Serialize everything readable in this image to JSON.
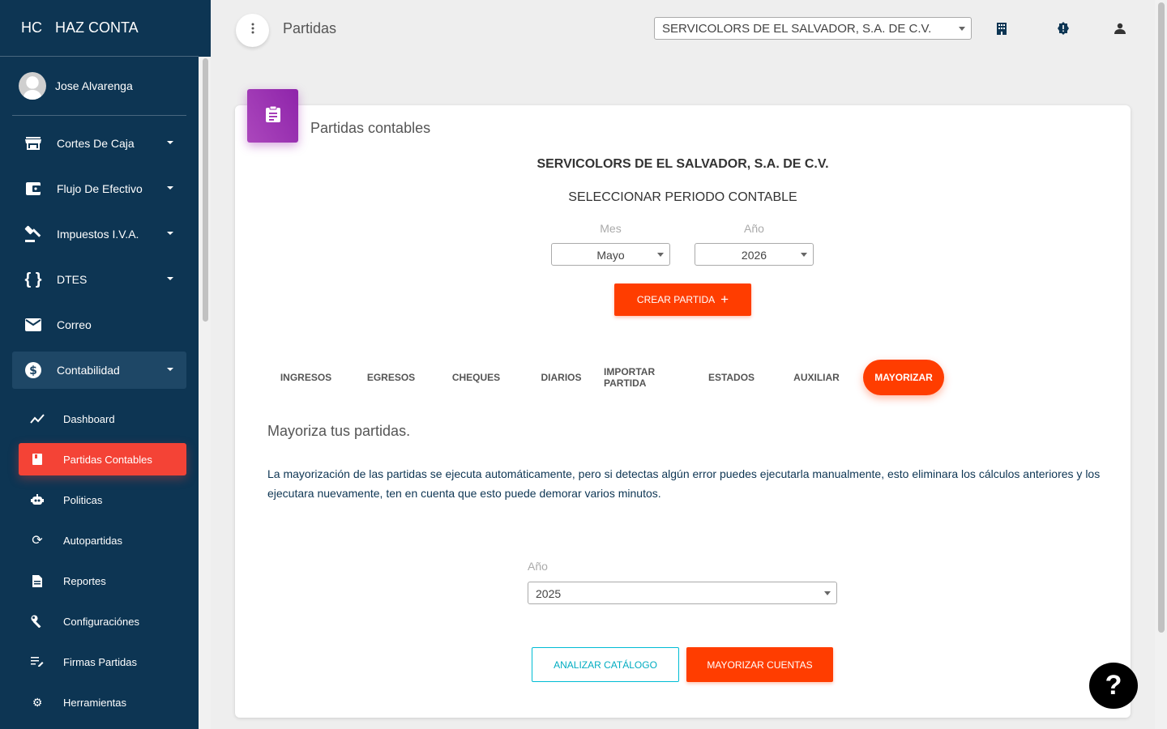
{
  "sidebar": {
    "brand_mini": "HC",
    "brand_name": "HAZ CONTA",
    "user_name": "Jose Alvarenga",
    "items": [
      {
        "label": "Cortes De Caja",
        "icon": "store-icon"
      },
      {
        "label": "Flujo De Efectivo",
        "icon": "wallet-icon"
      },
      {
        "label": "Impuestos I.V.A.",
        "icon": "gavel-icon"
      },
      {
        "label": "DTES",
        "icon": "braces-icon"
      },
      {
        "label": "Correo",
        "icon": "mail-icon"
      },
      {
        "label": "Contabilidad",
        "icon": "dollar-icon"
      }
    ],
    "sub_items": [
      {
        "label": "Dashboard",
        "icon": "trend-icon"
      },
      {
        "label": "Partidas Contables",
        "icon": "book-icon"
      },
      {
        "label": "Politicas",
        "icon": "robot-icon"
      },
      {
        "label": "Autopartidas",
        "icon": "sync-icon"
      },
      {
        "label": "Reportes",
        "icon": "document-icon"
      },
      {
        "label": "Configuraciónes",
        "icon": "wrench-icon"
      },
      {
        "label": "Firmas Partidas",
        "icon": "edit-list-icon"
      },
      {
        "label": "Herramientas",
        "icon": "gears-icon"
      }
    ]
  },
  "topbar": {
    "title": "Partidas",
    "company_selected": "SERVICOLORS DE EL SALVADOR, S.A. DE C.V.",
    "icons": [
      "building-icon",
      "alert-badge-icon",
      "person-icon"
    ]
  },
  "card": {
    "title": "Partidas contables",
    "company_name": "SERVICOLORS DE EL SALVADOR, S.A. DE C.V.",
    "period_title": "SELECCIONAR PERIODO CONTABLE",
    "month_label": "Mes",
    "month_value": "Mayo",
    "year_label": "Año",
    "year_value": "2026",
    "create_button": "CREAR PARTIDA",
    "tabs": [
      "INGRESOS",
      "EGRESOS",
      "CHEQUES",
      "DIARIOS",
      "IMPORTAR PARTIDA",
      "ESTADOS",
      "AUXILIAR",
      "MAYORIZAR"
    ],
    "active_tab": "MAYORIZAR",
    "section_title": "Mayoriza tus partidas.",
    "description": "La mayorización de las partidas se ejecuta automáticamente, pero si detectas algún error puedes ejecutarla manualmente, esto eliminara los cálculos anteriores y los ejecutara nuevamente, ten en cuenta que esto puede demorar varios minutos.",
    "mayor_year_label": "Año",
    "mayor_year_value": "2025",
    "analyze_button": "ANALIZAR CATÁLOGO",
    "mayorizar_button": "MAYORIZAR CUENTAS"
  },
  "help_button": "?",
  "colors": {
    "sidebar_bg": "#0d3553",
    "accent_orange": "#ff3d00",
    "active_red": "#f44336",
    "card_icon_purple": "#9c27b0",
    "outline_cyan": "#00bcd4"
  }
}
